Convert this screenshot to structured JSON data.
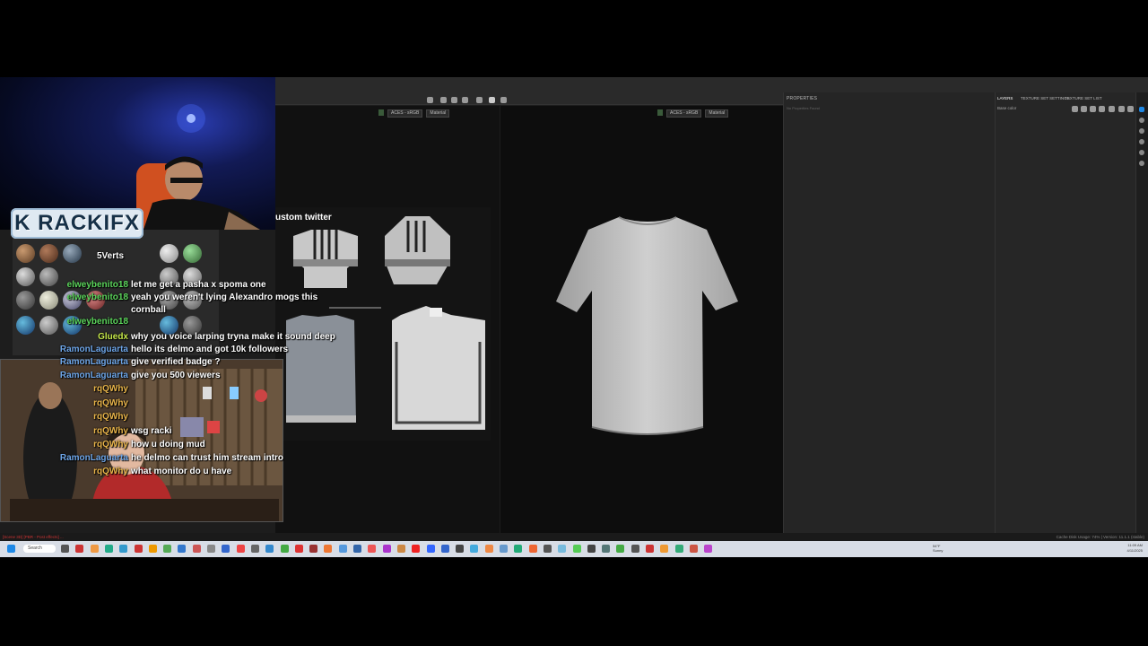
{
  "app": {
    "viewport_left_colorspace": "ACES - sRGB",
    "viewport_left_mode": "Material",
    "viewport_right_colorspace": "ACES - sRGB",
    "viewport_right_mode": "Material",
    "properties_title": "PROPERTIES",
    "properties_hint": "No Properties Found",
    "layers_tabs": [
      "LAYERS",
      "TEXTURE SET SETTINGS",
      "TEXTURE SET LIST"
    ],
    "layers_channel": "Base color",
    "uv_overlay_text": "ustom twitter",
    "status_error": "[Scene 3D] [PBR - Post effects] ...",
    "status_right": "Cache Disk Usage:  74%  |  Version: 11.1.1 (stable)"
  },
  "stream": {
    "logo_text": "K RACKIFX",
    "sub_line": "5Verts"
  },
  "chat": [
    {
      "user": "elweybenito18",
      "message": "let me get a pasha x spoma one",
      "color": "#5cd65c"
    },
    {
      "user": "elweybenito18",
      "message": "yeah you weren't lying Alexandro mogs this",
      "color": "#5cd65c"
    },
    {
      "user": "",
      "message": "cornball",
      "color": "#5cd65c"
    },
    {
      "user": "elweybenito18",
      "message": "",
      "color": "#5cd65c"
    },
    {
      "user": "Gluedx",
      "message": "why you voice larping tryna make it sound deep",
      "color": "#c6e84a"
    },
    {
      "user": "",
      "message": "hello its delmo and got 10k followers",
      "color": "#c6e84a"
    },
    {
      "user": "RamonLaguarta",
      "message": "",
      "color": "#6ea6e8"
    },
    {
      "user": "RamonLaguarta",
      "message": "give verified badge ?",
      "color": "#6ea6e8"
    },
    {
      "user": "RamonLaguarta",
      "message": "give you 500 viewers",
      "color": "#6ea6e8"
    },
    {
      "user": "rqQWhy",
      "message": "",
      "color": "#e8b44a"
    },
    {
      "user": "rqQWhy",
      "message": "",
      "color": "#e8b44a"
    },
    {
      "user": "rqQWhy",
      "message": "",
      "color": "#e8b44a"
    },
    {
      "user": "rqQWhy",
      "message": "wsg racki",
      "color": "#e8b44a"
    },
    {
      "user": "rqQWhy",
      "message": "how u doing mud",
      "color": "#e8b44a"
    },
    {
      "user": "RamonLaguarta",
      "message": "he delmo can trust him stream intro",
      "color": "#6ea6e8"
    },
    {
      "user": "rqQWhy",
      "message": "what monitor do u have",
      "color": "#e8b44a"
    }
  ],
  "taskbar": {
    "search_label": "Search",
    "weather": "54°F",
    "weather_sub": "Sunny",
    "time": "11:09 AM",
    "date": "4/11/2025"
  },
  "colors": {
    "accent": "#1e88e5",
    "error": "#cc3333"
  }
}
